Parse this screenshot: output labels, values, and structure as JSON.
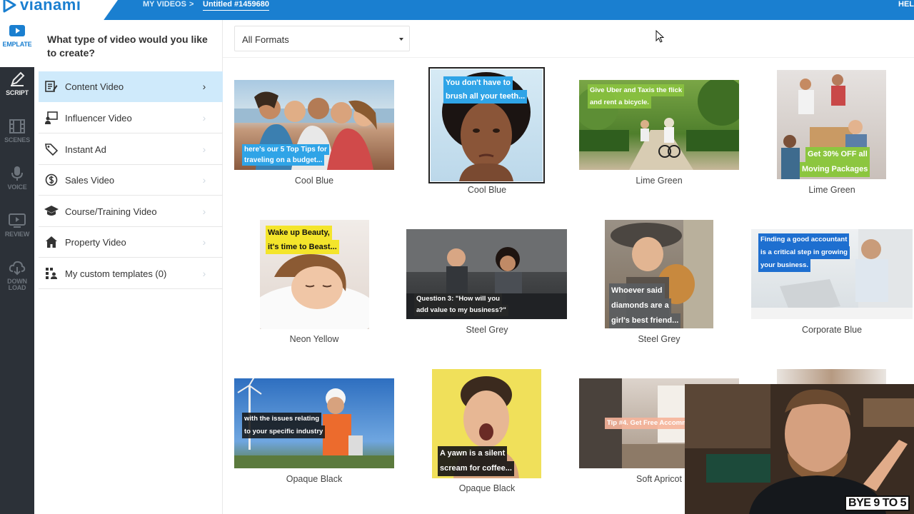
{
  "header": {
    "logo": "vianami",
    "breadcrumb_my_videos": "MY VIDEOS",
    "breadcrumb_sep": ">",
    "breadcrumb_current": "Untitled #1459680",
    "help": "HEL"
  },
  "rail": {
    "items": [
      {
        "label": "EMPLATE",
        "icon": "play-icon"
      },
      {
        "label": "SCRIPT",
        "icon": "pen-icon"
      },
      {
        "label": "SCENES",
        "icon": "film-icon"
      },
      {
        "label": "VOICE",
        "icon": "mic-icon"
      },
      {
        "label": "REVIEW",
        "icon": "play-screen-icon"
      },
      {
        "label": "DOWN\nLOAD",
        "icon": "cloud-download-icon"
      }
    ]
  },
  "type_panel": {
    "title": "What type of video would you like to create?",
    "items": [
      {
        "label": "Content Video",
        "icon": "edit-doc-icon",
        "selected": true
      },
      {
        "label": "Influencer Video",
        "icon": "presenter-icon",
        "selected": false
      },
      {
        "label": "Instant Ad",
        "icon": "tag-icon",
        "selected": false
      },
      {
        "label": "Sales Video",
        "icon": "dollar-badge-icon",
        "selected": false
      },
      {
        "label": "Course/Training Video",
        "icon": "graduation-cap-icon",
        "selected": false
      },
      {
        "label": "Property Video",
        "icon": "house-icon",
        "selected": false
      },
      {
        "label": "My custom templates (0)",
        "icon": "grid-user-icon",
        "selected": false
      }
    ]
  },
  "filter": {
    "selected": "All Formats"
  },
  "templates": [
    {
      "name": "Cool Blue",
      "caption": [
        "here's our 5 Top Tips for",
        "traveling on a budget..."
      ],
      "highlight": "5 Top Tips",
      "colors": {
        "accent": "#2fa4e7"
      }
    },
    {
      "name": "Cool Blue",
      "caption": [
        "You don't have to",
        "brush all your teeth..."
      ],
      "highlight": "don't have to",
      "colors": {
        "accent": "#2fa4e7"
      }
    },
    {
      "name": "Lime Green",
      "caption": [
        "Give Uber and Taxis the flick",
        "and rent a bicycle."
      ],
      "highlight": "rent a bicycle",
      "colors": {
        "accent": "#8cc63f"
      }
    },
    {
      "name": "Lime Green",
      "caption": [
        "Get 30% OFF all",
        "Moving Packages"
      ],
      "highlight": "30% OFF",
      "colors": {
        "accent": "#8cc63f"
      }
    },
    {
      "name": "Neon Yellow",
      "caption": [
        "Wake up Beauty,",
        "it's time to Beast..."
      ],
      "highlight": "to Beast...",
      "colors": {
        "accent": "#f4e52b"
      }
    },
    {
      "name": "Steel Grey",
      "caption": [
        "Question 3: \"How will you",
        "add value to my business?\""
      ],
      "highlight": "Question 3:",
      "colors": {
        "accent": "#6b6f74"
      }
    },
    {
      "name": "Steel Grey",
      "caption": [
        "Whoever said",
        "diamonds are a",
        "girl's best friend..."
      ],
      "highlight": "girl's best friend...",
      "colors": {
        "accent": "#6b6f74"
      }
    },
    {
      "name": "Corporate Blue",
      "caption": [
        "Finding a good accountant",
        "is a critical step in growing",
        "your business."
      ],
      "highlight": "critical step",
      "colors": {
        "accent": "#1e6fd0"
      }
    },
    {
      "name": "Opaque Black",
      "caption": [
        "with the issues relating",
        "to your specific industry"
      ],
      "highlight": "specific industry",
      "colors": {
        "accent": "#1a1a1a"
      }
    },
    {
      "name": "Opaque Black",
      "caption": [
        "A yawn is a silent",
        "scream for coffee..."
      ],
      "highlight": "silent scream",
      "colors": {
        "accent": "#1a1a1a"
      }
    },
    {
      "name": "Soft Apricot",
      "caption": [
        "Tip #4. Get Free Accomm"
      ],
      "highlight": "Tip #4. Get",
      "colors": {
        "accent": "#f6b49a"
      }
    },
    {
      "name": "",
      "caption": [],
      "highlight": "",
      "colors": {
        "accent": "#cccccc"
      }
    }
  ],
  "overlay": {
    "brand": "BYE 9 TO 5"
  }
}
